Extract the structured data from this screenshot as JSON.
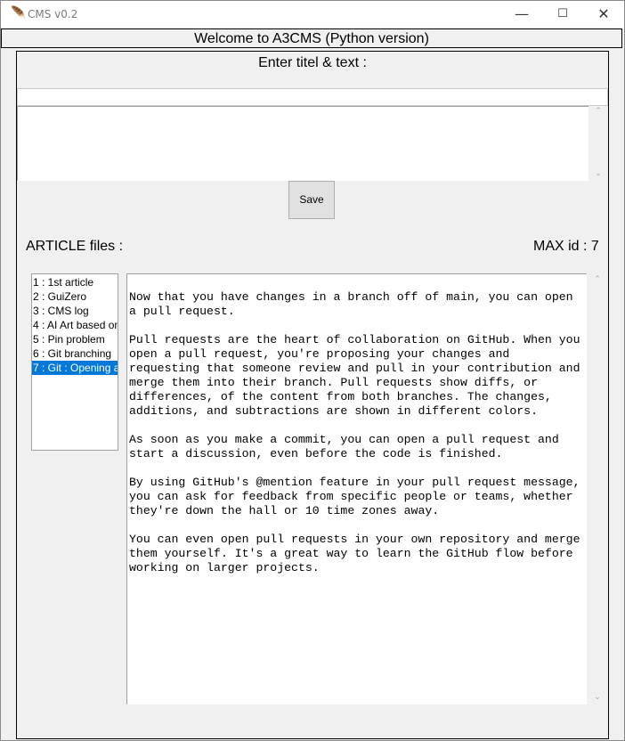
{
  "window": {
    "title": "CMS v0.2",
    "app_icon": "feather-icon",
    "controls": {
      "minimize": "—",
      "maximize": "☐",
      "close": "✕"
    }
  },
  "header": {
    "welcome": "Welcome to A3CMS (Python version)"
  },
  "editor": {
    "label": "Enter titel & text :",
    "title_value": "",
    "body_value": "",
    "save_label": "Save"
  },
  "articles": {
    "label": "ARTICLE files :",
    "max_id_label": "MAX id : 7",
    "items": [
      "1 : 1st article",
      "2 : GuiZero",
      "3 : CMS log",
      "4 : AI Art based on",
      "5 : Pin problem",
      "6 : Git branching",
      "7 : Git : Opening a"
    ],
    "selected_index": 6
  },
  "content": {
    "paragraphs": [
      "Now that you have changes in a branch off of main, you can open\na pull request.",
      "Pull requests are the heart of collaboration on GitHub. When you\nopen a pull request, you're proposing your changes and\nrequesting that someone review and pull in your contribution and\nmerge them into their branch. Pull requests show diffs, or\ndifferences, of the content from both branches. The changes,\nadditions, and subtractions are shown in different colors.",
      "As soon as you make a commit, you can open a pull request and\nstart a discussion, even before the code is finished.",
      "By using GitHub's @mention feature in your pull request message,\nyou can ask for feedback from specific people or teams, whether\nthey're down the hall or 10 time zones away.",
      "You can even open pull requests in your own repository and merge\nthem yourself. It's a great way to learn the GitHub flow before\nworking on larger projects."
    ]
  },
  "scrollbar": {
    "up": "⌃",
    "down": "⌄"
  },
  "colors": {
    "selection": "#0078d7",
    "background": "#f0f0f0"
  }
}
